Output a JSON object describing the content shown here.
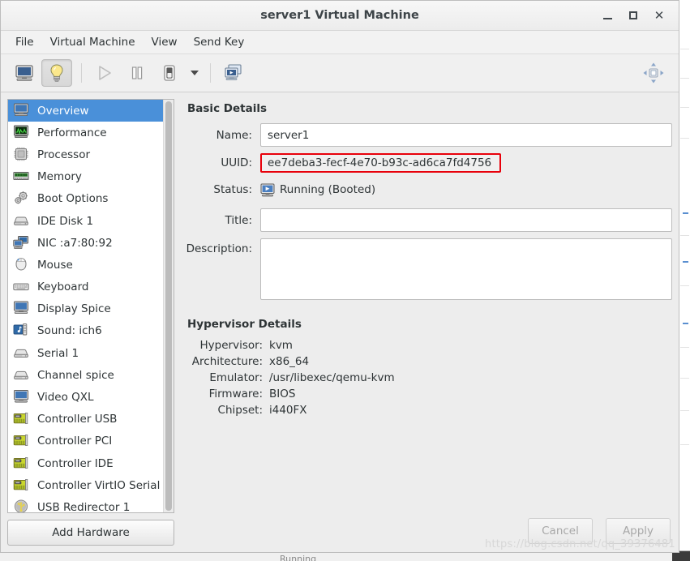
{
  "window": {
    "title": "server1 Virtual Machine",
    "controls": {
      "minimize": "–",
      "maximize": "□",
      "close": "✕"
    }
  },
  "menubar": {
    "items": [
      {
        "label": "File",
        "name": "menu-file"
      },
      {
        "label": "Virtual Machine",
        "name": "menu-virtual-machine"
      },
      {
        "label": "View",
        "name": "menu-view"
      },
      {
        "label": "Send Key",
        "name": "menu-send-key"
      }
    ]
  },
  "toolbar": {
    "buttons": [
      {
        "icon": "console-monitor-icon",
        "name": "show-console-button",
        "active": false,
        "enabled": true
      },
      {
        "icon": "lightbulb-details-icon",
        "name": "show-details-button",
        "active": true,
        "enabled": true
      },
      {
        "icon": "play-icon",
        "name": "run-button",
        "active": false,
        "enabled": false
      },
      {
        "icon": "pause-icon",
        "name": "pause-button",
        "active": false,
        "enabled": true
      },
      {
        "icon": "shutdown-icon",
        "name": "shutdown-button",
        "active": false,
        "enabled": true
      },
      {
        "icon": "chevron-down-icon",
        "name": "shutdown-options-dropdown",
        "active": false,
        "enabled": true
      },
      {
        "icon": "snapshots-icon",
        "name": "manage-snapshots-button",
        "active": false,
        "enabled": true
      }
    ],
    "right_button": {
      "icon": "fullscreen-icon",
      "name": "fullscreen-button"
    }
  },
  "sidebar": {
    "items": [
      {
        "label": "Overview",
        "icon": "monitor-icon",
        "selected": true
      },
      {
        "label": "Performance",
        "icon": "graph-monitor-icon",
        "selected": false
      },
      {
        "label": "Processor",
        "icon": "cpu-chip-icon",
        "selected": false
      },
      {
        "label": "Memory",
        "icon": "memory-ram-icon",
        "selected": false
      },
      {
        "label": "Boot Options",
        "icon": "gears-icon",
        "selected": false
      },
      {
        "label": "IDE Disk 1",
        "icon": "harddisk-icon",
        "selected": false
      },
      {
        "label": "NIC :a7:80:92",
        "icon": "network-icon",
        "selected": false
      },
      {
        "label": "Mouse",
        "icon": "mouse-icon",
        "selected": false
      },
      {
        "label": "Keyboard",
        "icon": "keyboard-icon",
        "selected": false
      },
      {
        "label": "Display Spice",
        "icon": "monitor-icon",
        "selected": false
      },
      {
        "label": "Sound: ich6",
        "icon": "sound-icon",
        "selected": false
      },
      {
        "label": "Serial 1",
        "icon": "serial-icon",
        "selected": false
      },
      {
        "label": "Channel spice",
        "icon": "serial-icon",
        "selected": false
      },
      {
        "label": "Video QXL",
        "icon": "video-icon",
        "selected": false
      },
      {
        "label": "Controller USB",
        "icon": "controller-card-icon",
        "selected": false
      },
      {
        "label": "Controller PCI",
        "icon": "controller-card-icon",
        "selected": false
      },
      {
        "label": "Controller IDE",
        "icon": "controller-card-icon",
        "selected": false
      },
      {
        "label": "Controller VirtIO Serial",
        "icon": "controller-card-icon",
        "selected": false
      },
      {
        "label": "USB Redirector 1",
        "icon": "usb-icon",
        "selected": false
      }
    ],
    "add_hardware_label": "Add Hardware"
  },
  "main": {
    "basic_details": {
      "heading": "Basic Details",
      "name_label": "Name:",
      "name_value": "server1",
      "name_placeholder": "",
      "uuid_label": "UUID:",
      "uuid_value": "ee7deba3-fecf-4e70-b93c-ad6ca7fd4756",
      "uuid_highlight_color": "#e8000b",
      "status_label": "Status:",
      "status_value": "Running (Booted)",
      "status_icon": "running-monitor-icon",
      "title_label": "Title:",
      "title_value": "",
      "title_placeholder": "",
      "description_label": "Description:",
      "description_value": "",
      "description_placeholder": ""
    },
    "hypervisor_details": {
      "heading": "Hypervisor Details",
      "rows": [
        {
          "label": "Hypervisor:",
          "value": "kvm"
        },
        {
          "label": "Architecture:",
          "value": "x86_64"
        },
        {
          "label": "Emulator:",
          "value": "/usr/libexec/qemu-kvm"
        },
        {
          "label": "Firmware:",
          "value": "BIOS"
        },
        {
          "label": "Chipset:",
          "value": "i440FX"
        }
      ]
    }
  },
  "footer": {
    "cancel_label": "Cancel",
    "apply_label": "Apply"
  },
  "watermark": {
    "text": "https://blog.csdn.net/qq_39376481"
  },
  "background": {
    "bottom_text": "Running"
  },
  "colors": {
    "selection_blue": "#4a90d9",
    "highlight_red": "#e8000b",
    "window_bg": "#ededed",
    "panel_white": "#ffffff"
  }
}
